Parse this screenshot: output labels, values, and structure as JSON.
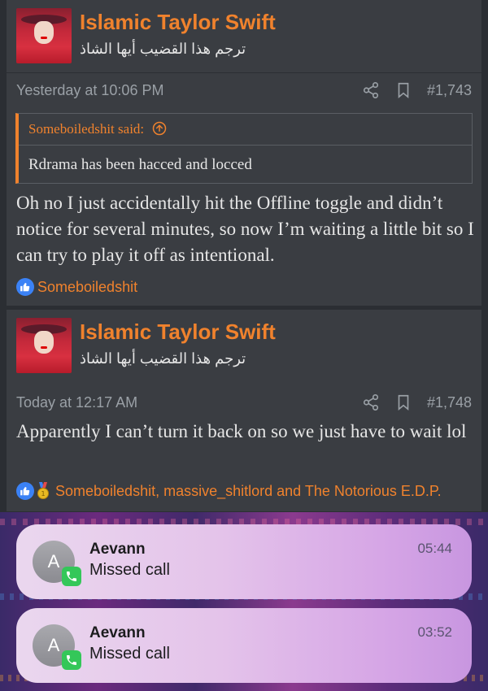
{
  "posts": [
    {
      "username": "Islamic Taylor Swift",
      "user_title": "ترجم هذا القضيب أيها الشاذ",
      "timestamp": "Yesterday at 10:06 PM",
      "post_number": "#1,743",
      "quote": {
        "author_said": "Someboiledshit said:",
        "text": "Rdrama has been hacced and locced"
      },
      "message": "Oh no I just accidentally hit the Offline toggle and didn’t notice for several minutes, so now I’m waiting a little bit so I can try to play it off as intentional.",
      "reactions": "Someboiledshit"
    },
    {
      "username": "Islamic Taylor Swift",
      "user_title": "ترجم هذا القضيب أيها الشاذ",
      "timestamp": "Today at 12:17 AM",
      "post_number": "#1,748",
      "message": "Apparently I can’t turn it back on so we just have to wait lol",
      "reactions": "Someboiledshit, massive_shitlord and The Notorious E.D.P."
    }
  ],
  "notifications": [
    {
      "avatar_letter": "A",
      "name": "Aevann",
      "text": "Missed call",
      "time": "05:44"
    },
    {
      "avatar_letter": "A",
      "name": "Aevann",
      "text": "Missed call",
      "time": "03:52"
    }
  ],
  "colors": {
    "accent": "#f0822d",
    "background": "#2b2e33",
    "post_background": "#3a3d42",
    "like_blue": "#3b82f6",
    "phone_green": "#34c759"
  },
  "icons": [
    "share-icon",
    "bookmark-icon",
    "arrow-up-circle-icon",
    "like-icon",
    "medal-icon",
    "phone-icon"
  ]
}
